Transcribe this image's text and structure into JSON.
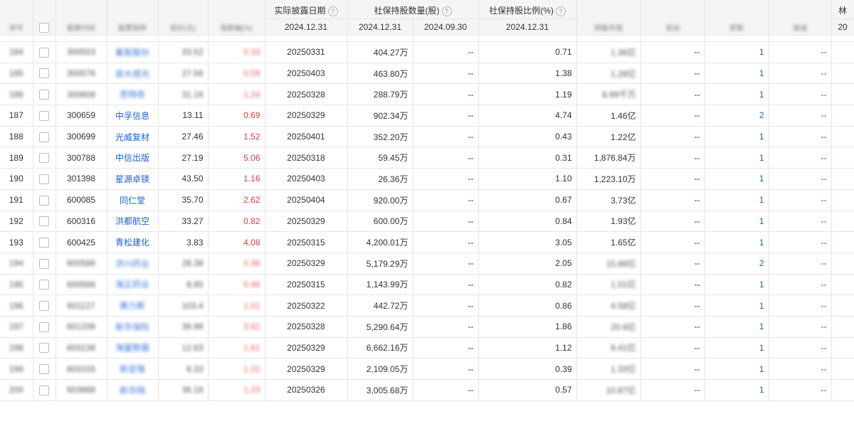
{
  "columns": {
    "disclosure_date": "实际披露日期",
    "holding_qty": "社保持股数量(股)",
    "holding_ratio": "社保持股比例(%)",
    "help_mark": "?",
    "date_current": "2024.12.31",
    "date_prev": "2024.09.30",
    "edge_top": "林",
    "edge_bottom": "20"
  },
  "rows": [
    {
      "idx": "184",
      "code": "300553",
      "name": "集智股份",
      "price": "33.52",
      "chg": "0.33",
      "date": "20250331",
      "qty": "404.27万",
      "prev": "--",
      "ratio": "0.71",
      "mcap": "1.36亿",
      "c11": "--",
      "count": "1",
      "c13": "--",
      "blurred": true
    },
    {
      "idx": "185",
      "code": "300576",
      "name": "容大感光",
      "price": "27.56",
      "chg": "0.59",
      "date": "20250403",
      "qty": "463.80万",
      "prev": "--",
      "ratio": "1.38",
      "mcap": "1.28亿",
      "c11": "--",
      "count": "1",
      "c13": "--",
      "blurred": true
    },
    {
      "idx": "186",
      "code": "300608",
      "name": "思特奇",
      "price": "31.16",
      "chg": "1.24",
      "date": "20250328",
      "qty": "288.79万",
      "prev": "--",
      "ratio": "1.19",
      "mcap": "8.99千万",
      "c11": "--",
      "count": "1",
      "c13": "--",
      "blurred": true
    },
    {
      "idx": "187",
      "code": "300659",
      "name": "中孚信息",
      "price": "13.11",
      "chg": "0.69",
      "date": "20250329",
      "qty": "902.34万",
      "prev": "--",
      "ratio": "4.74",
      "mcap": "1.46亿",
      "c11": "--",
      "count": "2",
      "c13": "--",
      "blurred": false
    },
    {
      "idx": "188",
      "code": "300699",
      "name": "光威复材",
      "price": "27.46",
      "chg": "1.52",
      "date": "20250401",
      "qty": "352.20万",
      "prev": "--",
      "ratio": "0.43",
      "mcap": "1.22亿",
      "c11": "--",
      "count": "1",
      "c13": "--",
      "blurred": false
    },
    {
      "idx": "189",
      "code": "300788",
      "name": "中信出版",
      "price": "27.19",
      "chg": "5.06",
      "date": "20250318",
      "qty": "59.45万",
      "prev": "--",
      "ratio": "0.31",
      "mcap": "1,876.84万",
      "c11": "--",
      "count": "1",
      "c13": "--",
      "blurred": false
    },
    {
      "idx": "190",
      "code": "301398",
      "name": "星源卓镁",
      "price": "43.50",
      "chg": "1.16",
      "date": "20250403",
      "qty": "26.36万",
      "prev": "--",
      "ratio": "1.10",
      "mcap": "1,223.10万",
      "c11": "--",
      "count": "1",
      "c13": "--",
      "blurred": false
    },
    {
      "idx": "191",
      "code": "600085",
      "name": "同仁堂",
      "price": "35.70",
      "chg": "2.62",
      "date": "20250404",
      "qty": "920.00万",
      "prev": "--",
      "ratio": "0.67",
      "mcap": "3.73亿",
      "c11": "--",
      "count": "1",
      "c13": "--",
      "blurred": false
    },
    {
      "idx": "192",
      "code": "600316",
      "name": "洪都航空",
      "price": "33.27",
      "chg": "0.82",
      "date": "20250329",
      "qty": "600.00万",
      "prev": "--",
      "ratio": "0.84",
      "mcap": "1.93亿",
      "c11": "--",
      "count": "1",
      "c13": "--",
      "blurred": false
    },
    {
      "idx": "193",
      "code": "600425",
      "name": "青松建化",
      "price": "3.83",
      "chg": "4.08",
      "date": "20250315",
      "qty": "4,200.01万",
      "prev": "--",
      "ratio": "3.05",
      "mcap": "1.65亿",
      "c11": "--",
      "count": "1",
      "c13": "--",
      "blurred": false
    },
    {
      "idx": "194",
      "code": "600566",
      "name": "济川药业",
      "price": "28.38",
      "chg": "0.36",
      "date": "20250329",
      "qty": "5,179.29万",
      "prev": "--",
      "ratio": "2.05",
      "mcap": "15.88亿",
      "c11": "--",
      "count": "2",
      "c13": "--",
      "blurred": true
    },
    {
      "idx": "195",
      "code": "600566",
      "name": "海正药业",
      "price": "8.85",
      "chg": "5.46",
      "date": "20250315",
      "qty": "1,143.99万",
      "prev": "--",
      "ratio": "0.82",
      "mcap": "1.01亿",
      "c11": "--",
      "count": "1",
      "c13": "--",
      "blurred": true
    },
    {
      "idx": "196",
      "code": "601127",
      "name": "赛力斯",
      "price": "103.4",
      "chg": "1.01",
      "date": "20250322",
      "qty": "442.72万",
      "prev": "--",
      "ratio": "0.86",
      "mcap": "4.58亿",
      "c11": "--",
      "count": "1",
      "c13": "--",
      "blurred": true
    },
    {
      "idx": "197",
      "code": "601336",
      "name": "新华保险",
      "price": "38.98",
      "chg": "3.62",
      "date": "20250328",
      "qty": "5,290.64万",
      "prev": "--",
      "ratio": "1.86",
      "mcap": "20.6亿",
      "c11": "--",
      "count": "1",
      "c13": "--",
      "blurred": true
    },
    {
      "idx": "198",
      "code": "603138",
      "name": "海量数据",
      "price": "12.63",
      "chg": "1.61",
      "date": "20250329",
      "qty": "6,662.16万",
      "prev": "--",
      "ratio": "1.12",
      "mcap": "8.41亿",
      "c11": "--",
      "count": "1",
      "c13": "--",
      "blurred": true
    },
    {
      "idx": "199",
      "code": "603155",
      "name": "新亚强",
      "price": "6.33",
      "chg": "1.22",
      "date": "20250329",
      "qty": "2,109.05万",
      "prev": "--",
      "ratio": "0.39",
      "mcap": "1.33亿",
      "c11": "--",
      "count": "1",
      "c13": "--",
      "blurred": true
    },
    {
      "idx": "200",
      "code": "603888",
      "name": "新华网",
      "price": "36.18",
      "chg": "1.23",
      "date": "20250326",
      "qty": "3,005.68万",
      "prev": "--",
      "ratio": "0.57",
      "mcap": "10.87亿",
      "c11": "--",
      "count": "1",
      "c13": "--",
      "blurred": true
    }
  ],
  "colors": {
    "up": "#e23b3b",
    "link": "#1b5fd1",
    "header_bg": "#f5f5f5",
    "border": "#e6e6e6"
  }
}
